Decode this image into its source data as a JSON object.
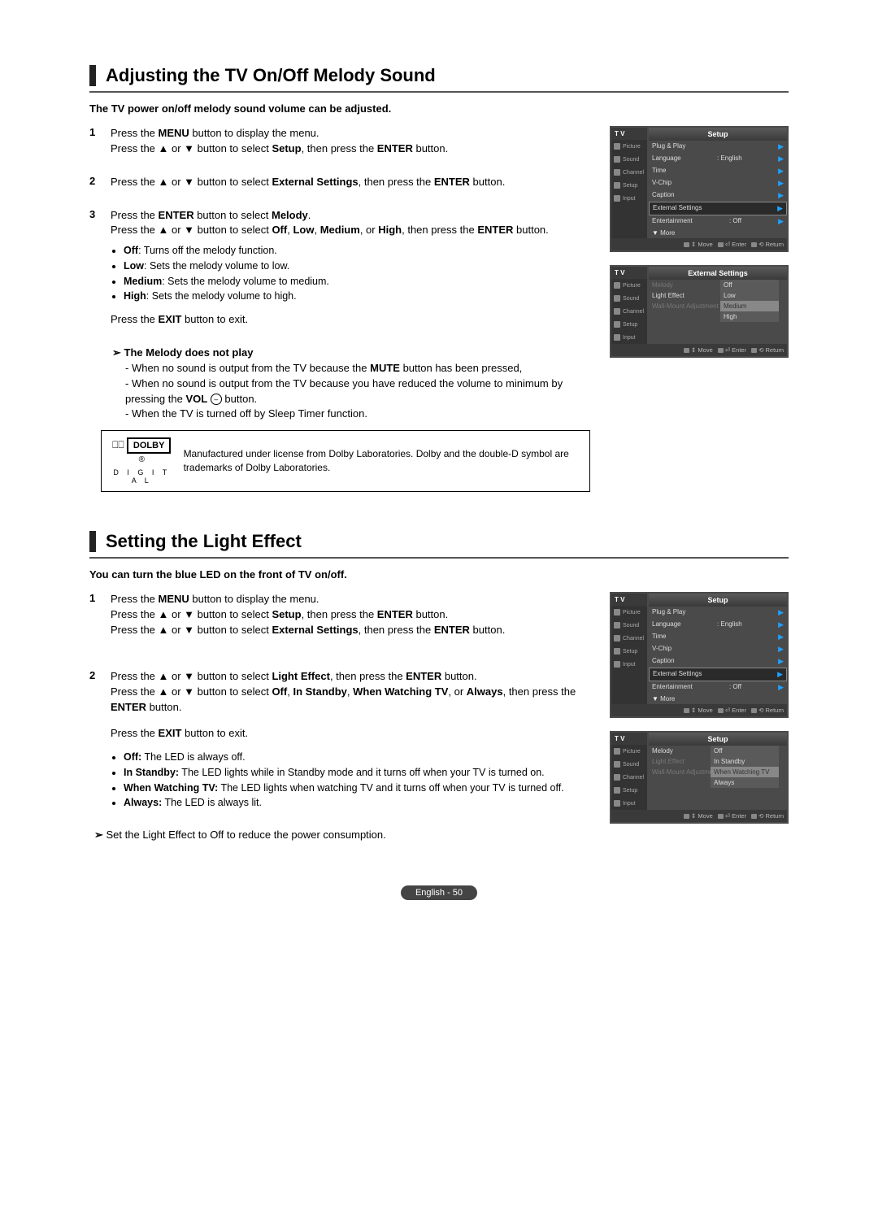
{
  "section1": {
    "title": "Adjusting the TV On/Off Melody Sound",
    "intro": "The TV power on/off melody sound volume can be adjusted.",
    "step1_num": "1",
    "step1_l1a": "Press the ",
    "step1_l1b": "MENU",
    "step1_l1c": " button to display the menu.",
    "step1_l2a": "Press the ▲ or ▼ button to select ",
    "step1_l2b": "Setup",
    "step1_l2c": ", then press the ",
    "step1_l2d": "ENTER",
    "step1_l2e": " button.",
    "step2_num": "2",
    "step2_a": "Press the ▲ or ▼ button to select ",
    "step2_b": "External Settings",
    "step2_c": ", then press the ",
    "step2_d": "ENTER",
    "step2_e": " button.",
    "step3_num": "3",
    "step3_l1a": "Press the ",
    "step3_l1b": "ENTER",
    "step3_l1c": " button to select ",
    "step3_l1d": "Melody",
    "step3_l1e": ".",
    "step3_l2a": "Press the ▲ or ▼ button to select ",
    "step3_l2b": "Off",
    "step3_l2c": ", ",
    "step3_l2d": "Low",
    "step3_l2e": ", ",
    "step3_l2f": "Medium",
    "step3_l2g": ", or ",
    "step3_l2h": "High",
    "step3_l2i": ", then press the ",
    "step3_l2j": "ENTER",
    "step3_l2k": " button.",
    "bullets": {
      "b1a": "Off",
      "b1b": ": Turns off the melody function.",
      "b2a": "Low",
      "b2b": ": Sets the melody volume to low.",
      "b3a": "Medium",
      "b3b": ": Sets the melody volume to medium.",
      "b4a": "High",
      "b4b": ": Sets the melody volume to high."
    },
    "exit_a": "Press the ",
    "exit_b": "EXIT",
    "exit_c": " button to exit.",
    "note_title": "The Melody does not play",
    "note1a": "- When no sound is output from the TV because the ",
    "note1b": "MUTE",
    "note1c": " button has been pressed,",
    "note2a": "- When no sound is output from the TV because you have reduced the volume to minimum by pressing the ",
    "note2b": "VOL",
    "note2c": " button.",
    "note2_sym": "–",
    "note3": "- When the TV is turned off by Sleep Timer function.",
    "dolby_logo": "DOLBY",
    "dolby_digital": "D I G I T A L",
    "dolby_marks": "⎕⎕",
    "dolby_text": "Manufactured under license from Dolby Laboratories. Dolby and the double-D symbol are trademarks of Dolby Laboratories."
  },
  "section2": {
    "title": "Setting the Light Effect",
    "intro": "You can turn the blue LED on the front of TV on/off.",
    "step1_num": "1",
    "step1_l1a": "Press the ",
    "step1_l1b": "MENU",
    "step1_l1c": " button to display the menu.",
    "step1_l2a": "Press the ▲ or ▼ button to select ",
    "step1_l2b": "Setup",
    "step1_l2c": ", then press the ",
    "step1_l2d": "ENTER",
    "step1_l2e": " button.",
    "step1_l3a": "Press the ▲ or ▼ button to select ",
    "step1_l3b": "External Settings",
    "step1_l3c": ", then press the ",
    "step1_l3d": "ENTER",
    "step1_l3e": " button.",
    "step2_num": "2",
    "step2_l1a": "Press the ▲ or ▼ button to select ",
    "step2_l1b": "Light Effect",
    "step2_l1c": ", then press the ",
    "step2_l1d": "ENTER",
    "step2_l1e": " button.",
    "step2_l2a": "Press the ▲ or ▼ button to select ",
    "step2_l2b": "Off",
    "step2_l2c": ", ",
    "step2_l2d": "In Standby",
    "step2_l2e": ", ",
    "step2_l2f": "When Watching TV",
    "step2_l2g": ", or ",
    "step2_l2h": "Always",
    "step2_l2i": ", then press the ",
    "step2_l2j": "ENTER",
    "step2_l2k": " button.",
    "exit_a": "Press the ",
    "exit_b": "EXIT",
    "exit_c": " button to exit.",
    "bullets": {
      "b1a": "Off:",
      "b1b": " The LED is always off.",
      "b2a": "In Standby:",
      "b2b": " The LED lights while in Standby mode and it turns off when your TV is turned on.",
      "b3a": "When Watching TV:",
      "b3b": " The LED lights when watching TV and it turns off when your TV is turned off.",
      "b4a": "Always:",
      "b4b": " The LED is always lit."
    },
    "tip": "Set the Light Effect to Off to reduce the power consumption."
  },
  "osd_common": {
    "tv": "T V",
    "side": {
      "picture": "Picture",
      "sound": "Sound",
      "channel": "Channel",
      "setup": "Setup",
      "input": "Input"
    },
    "footer": {
      "move": "Move",
      "enter": "Enter",
      "return": "Return",
      "updn": "⇕",
      "ent": "⏎",
      "ret": "⟲"
    }
  },
  "osd1": {
    "head": "Setup",
    "rows": {
      "plug": "Plug & Play",
      "lang": "Language",
      "lang_v": ": English",
      "time": "Time",
      "vchip": "V-Chip",
      "caption": "Caption",
      "ext": "External Settings",
      "ent": "Entertainment",
      "ent_v": ": Off",
      "more": "More"
    }
  },
  "osd2": {
    "head": "External Settings",
    "rows": {
      "melody": "Melody",
      "light": "Light Effect",
      "wall": "Wall-Mount Adjustment"
    },
    "drop": {
      "off": "Off",
      "low": "Low",
      "medium": "Medium",
      "high": "High"
    }
  },
  "osd3": {
    "head": "Setup",
    "rows": {
      "plug": "Plug & Play",
      "lang": "Language",
      "lang_v": ": English",
      "time": "Time",
      "vchip": "V-Chip",
      "caption": "Caption",
      "ext": "External Settings",
      "ent": "Entertainment",
      "ent_v": ": Off",
      "more": "More"
    }
  },
  "osd4": {
    "head": "Setup",
    "rows": {
      "melody": "Melody",
      "light": "Light Effect",
      "wall": "Wall-Mount Adjustment"
    },
    "drop": {
      "off": "Off",
      "std": "In Standby",
      "watch": "When Watching TV",
      "always": "Always"
    }
  },
  "footer": "English - 50"
}
